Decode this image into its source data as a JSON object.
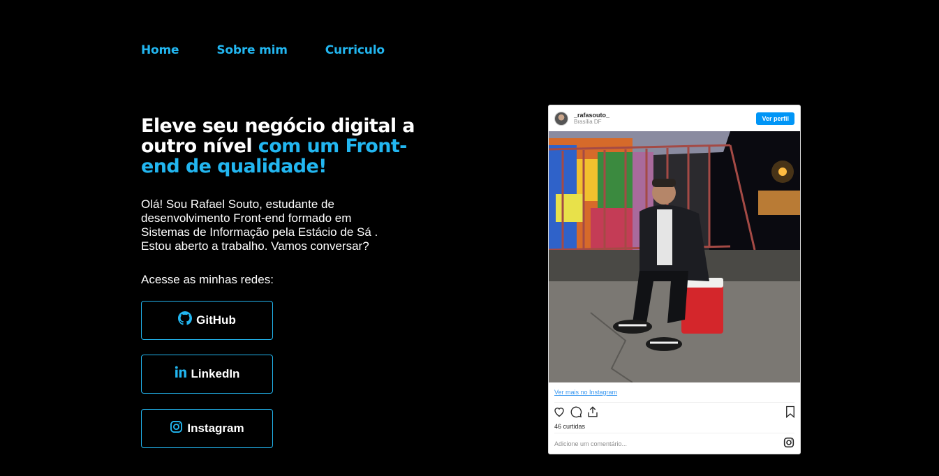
{
  "nav": {
    "items": [
      {
        "label": "Home"
      },
      {
        "label": "Sobre mim"
      },
      {
        "label": "Curriculo"
      }
    ]
  },
  "hero": {
    "headline_white": "Eleve seu negócio digital a outro nível ",
    "headline_accent": "com um Front-end de qualidade!",
    "intro": "Olá! Sou Rafael Souto, estudante de desenvolvimento Front-end formado em Sistemas de Informação pela Estácio de Sá . Estou aberto a trabalho. Vamos conversar?",
    "networks_label": "Acesse as minhas redes:"
  },
  "buttons": {
    "github": "GitHub",
    "linkedin": "LinkedIn",
    "instagram": "Instagram"
  },
  "instagram_card": {
    "username": "_rafasouto_",
    "location": "Brasília DF",
    "view_profile": "Ver perfil",
    "more_link": "Ver mais no Instagram",
    "likes": "46 curtidas",
    "comment_placeholder": "Adicione um comentário..."
  },
  "colors": {
    "background": "#000000",
    "accent": "#22b6f0",
    "instagram_blue": "#0095f6"
  },
  "icons": [
    "github-icon",
    "linkedin-icon",
    "instagram-icon",
    "heart-icon",
    "comment-icon",
    "share-icon",
    "bookmark-icon"
  ]
}
